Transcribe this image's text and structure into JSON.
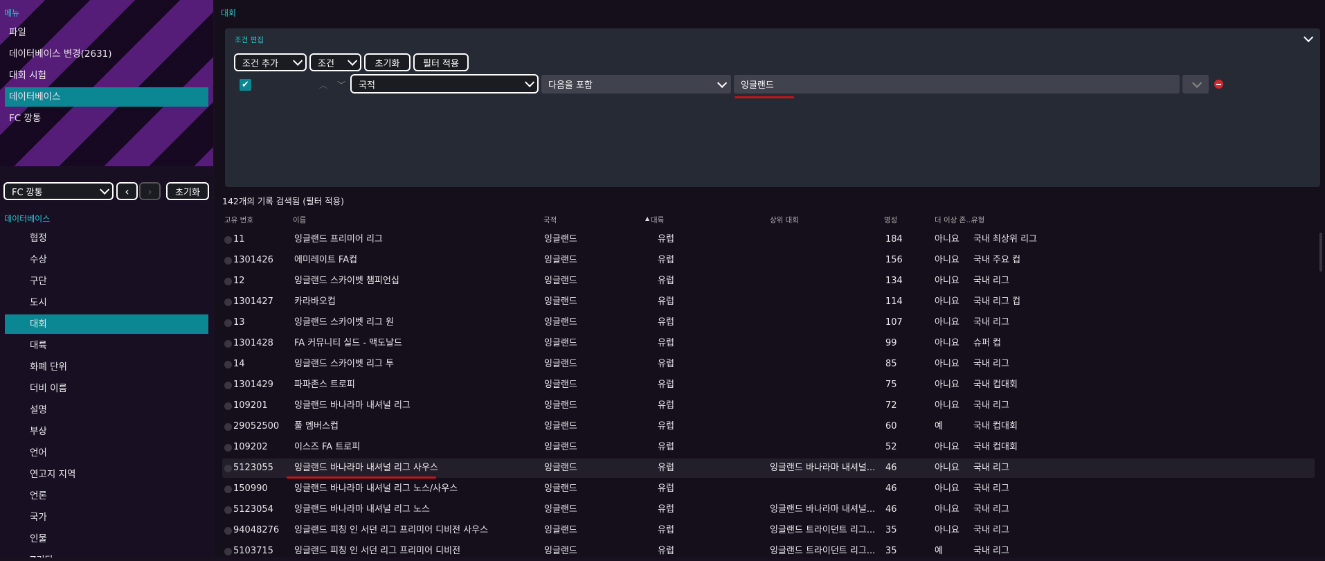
{
  "sidebar": {
    "menu_title": "메뉴",
    "menu_items": [
      "파일",
      "데이터베이스 변경(2631)",
      "대회 시험",
      "데이터베이스",
      "FC 깡통"
    ],
    "active_menu_index": 3,
    "club_select": "FC 깡통",
    "reset_label": "초기화",
    "db_title": "데이터베이스",
    "db_items": [
      "협정",
      "수상",
      "구단",
      "도시",
      "대회",
      "대륙",
      "화폐 단위",
      "더비 이름",
      "설명",
      "부상",
      "언어",
      "연고지 지역",
      "언론",
      "국가",
      "인물",
      "Z기타"
    ],
    "active_db_index": 4
  },
  "main": {
    "title": "대회",
    "filter": {
      "title": "조건 편집",
      "add_condition": "조건 추가",
      "condition": "조건",
      "reset": "초기화",
      "apply": "필터 적용",
      "field": "국적",
      "operator": "다음을 포함",
      "value": "잉글랜드"
    },
    "results_count": "142개의 기록 검색됨 (필터 적용)",
    "columns": [
      "고유 번호",
      "이름",
      "국적",
      "대륙",
      "상위 대회",
      "명성",
      "더 이상 존...",
      "유형"
    ],
    "rows": [
      {
        "id": "11",
        "name": "잉글랜드 프리미어 리그",
        "nation": "잉글랜드",
        "continent": "유럽",
        "parent": "",
        "rep": "184",
        "extinct": "아니요",
        "type": "국내 최상위 리그"
      },
      {
        "id": "1301426",
        "name": "에미레이트 FA컵",
        "nation": "잉글랜드",
        "continent": "유럽",
        "parent": "",
        "rep": "156",
        "extinct": "아니요",
        "type": "국내 주요 컵"
      },
      {
        "id": "12",
        "name": "잉글랜드 스카이벳 챔피언십",
        "nation": "잉글랜드",
        "continent": "유럽",
        "parent": "",
        "rep": "134",
        "extinct": "아니요",
        "type": "국내 리그"
      },
      {
        "id": "1301427",
        "name": "카라바오컵",
        "nation": "잉글랜드",
        "continent": "유럽",
        "parent": "",
        "rep": "114",
        "extinct": "아니요",
        "type": "국내 리그 컵"
      },
      {
        "id": "13",
        "name": "잉글랜드 스카이벳 리그 원",
        "nation": "잉글랜드",
        "continent": "유럽",
        "parent": "",
        "rep": "107",
        "extinct": "아니요",
        "type": "국내 리그"
      },
      {
        "id": "1301428",
        "name": "FA 커뮤니티 실드 - 맥도날드",
        "nation": "잉글랜드",
        "continent": "유럽",
        "parent": "",
        "rep": "99",
        "extinct": "아니요",
        "type": "슈퍼 컵"
      },
      {
        "id": "14",
        "name": "잉글랜드 스카이벳 리그 투",
        "nation": "잉글랜드",
        "continent": "유럽",
        "parent": "",
        "rep": "85",
        "extinct": "아니요",
        "type": "국내 리그"
      },
      {
        "id": "1301429",
        "name": "파파존스 트로피",
        "nation": "잉글랜드",
        "continent": "유럽",
        "parent": "",
        "rep": "75",
        "extinct": "아니요",
        "type": "국내 컵대회"
      },
      {
        "id": "109201",
        "name": "잉글랜드 바나라마 내셔널 리그",
        "nation": "잉글랜드",
        "continent": "유럽",
        "parent": "",
        "rep": "72",
        "extinct": "아니요",
        "type": "국내 리그"
      },
      {
        "id": "29052500",
        "name": "풀 멤버스컵",
        "nation": "잉글랜드",
        "continent": "유럽",
        "parent": "",
        "rep": "60",
        "extinct": "예",
        "type": "국내 컵대회"
      },
      {
        "id": "109202",
        "name": "이스즈 FA 트로피",
        "nation": "잉글랜드",
        "continent": "유럽",
        "parent": "",
        "rep": "52",
        "extinct": "아니요",
        "type": "국내 컵대회"
      },
      {
        "id": "5123055",
        "name": "잉글랜드 바나라마 내셔널 리그 사우스",
        "nation": "잉글랜드",
        "continent": "유럽",
        "parent": "잉글랜드 바나라마 내셔널...",
        "rep": "46",
        "extinct": "아니요",
        "type": "국내 리그"
      },
      {
        "id": "150990",
        "name": "잉글랜드 바나라마 내셔널 리그 노스/사우스",
        "nation": "잉글랜드",
        "continent": "유럽",
        "parent": "",
        "rep": "46",
        "extinct": "아니요",
        "type": "국내 리그"
      },
      {
        "id": "5123054",
        "name": "잉글랜드 바나라마 내셔널 리그 노스",
        "nation": "잉글랜드",
        "continent": "유럽",
        "parent": "잉글랜드 바나라마 내셔널...",
        "rep": "46",
        "extinct": "아니요",
        "type": "국내 리그"
      },
      {
        "id": "94048276",
        "name": "잉글랜드 피칭 인 서던 리그 프리미어 디비전 사우스",
        "nation": "잉글랜드",
        "continent": "유럽",
        "parent": "잉글랜드 트라이던트 리그...",
        "rep": "35",
        "extinct": "아니요",
        "type": "국내 리그"
      },
      {
        "id": "5103715",
        "name": "잉글랜드 피칭 인 서던 리그 프리미어 디비전",
        "nation": "잉글랜드",
        "continent": "유럽",
        "parent": "잉글랜드 트라이던트 리그...",
        "rep": "35",
        "extinct": "예",
        "type": "국내 리그"
      }
    ],
    "highlighted_row_index": 11
  },
  "colors": {
    "accent": "#0b8793",
    "accent_text": "#27c7d4",
    "annotation": "#c4141d"
  }
}
